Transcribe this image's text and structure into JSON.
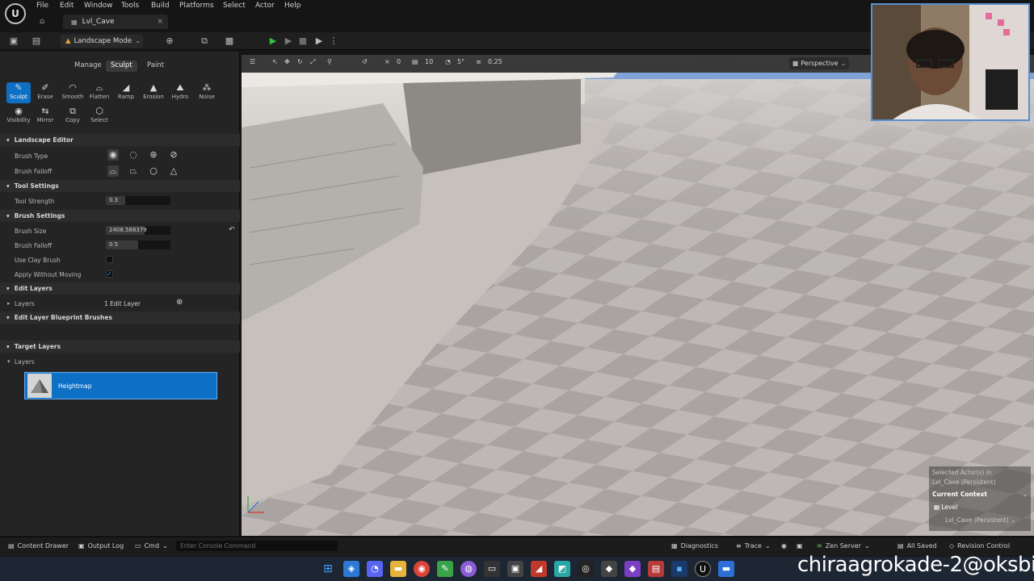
{
  "menu": [
    "File",
    "Edit",
    "Window",
    "Tools",
    "Build",
    "Platforms",
    "Select",
    "Actor",
    "Help"
  ],
  "level_tab": "Lvl_Cave",
  "mode_dropdown": "Landscape Mode",
  "mode_tabs": [
    "Manage",
    "Sculpt",
    "Paint"
  ],
  "tools_row1": [
    "Sculpt",
    "Erase",
    "Smooth",
    "Flatten",
    "Ramp",
    "Erosion",
    "Hydro",
    "Noise"
  ],
  "tools_row2": [
    "Visibility",
    "Mirror",
    "Copy",
    "Select"
  ],
  "sections": {
    "landscape_editor": "Landscape Editor",
    "tool_settings": "Tool Settings",
    "brush_settings": "Brush Settings",
    "edit_layers": "Edit Layers",
    "edit_layer_bp": "Edit Layer Blueprint Brushes",
    "target_layers": "Target Layers"
  },
  "props": {
    "brush_type": "Brush Type",
    "brush_falloff_shape": "Brush Falloff",
    "tool_strength": "Tool Strength",
    "tool_strength_val": "0.3",
    "brush_size": "Brush Size",
    "brush_size_val": "2408.588379",
    "brush_falloff": "Brush Falloff",
    "brush_falloff_val": "0.5",
    "use_clay": "Use Clay Brush",
    "apply_without_moving": "Apply Without Moving",
    "layers": "Layers",
    "edit_layer_count": "1 Edit Layer",
    "target_layers_label": "Layers",
    "heightmap": "Heightmap"
  },
  "viewport": {
    "perspective": "Perspective",
    "grid_snap": "10",
    "rot_snap": "5°",
    "scale_snap": "0.25",
    "cam_zero": "0"
  },
  "context": {
    "selected": "Selected Actor(s) in",
    "selected2": "Lvl_Cave (Persistent)",
    "current": "Current Context",
    "level": "Level",
    "persistent": "Lvl_Cave (Persistent)"
  },
  "statusbar": {
    "content_drawer": "Content Drawer",
    "output_log": "Output Log",
    "cmd": "Cmd",
    "console_placeholder": "Enter Console Command",
    "diagnostics": "Diagnostics",
    "trace": "Trace",
    "zen": "Zen Server",
    "saved": "All Saved",
    "revision": "Revision Control"
  },
  "watermark": "chiraagrokade-2@oksbi",
  "colors": {
    "accent": "#0e70c4",
    "play": "#3cbf3c"
  }
}
